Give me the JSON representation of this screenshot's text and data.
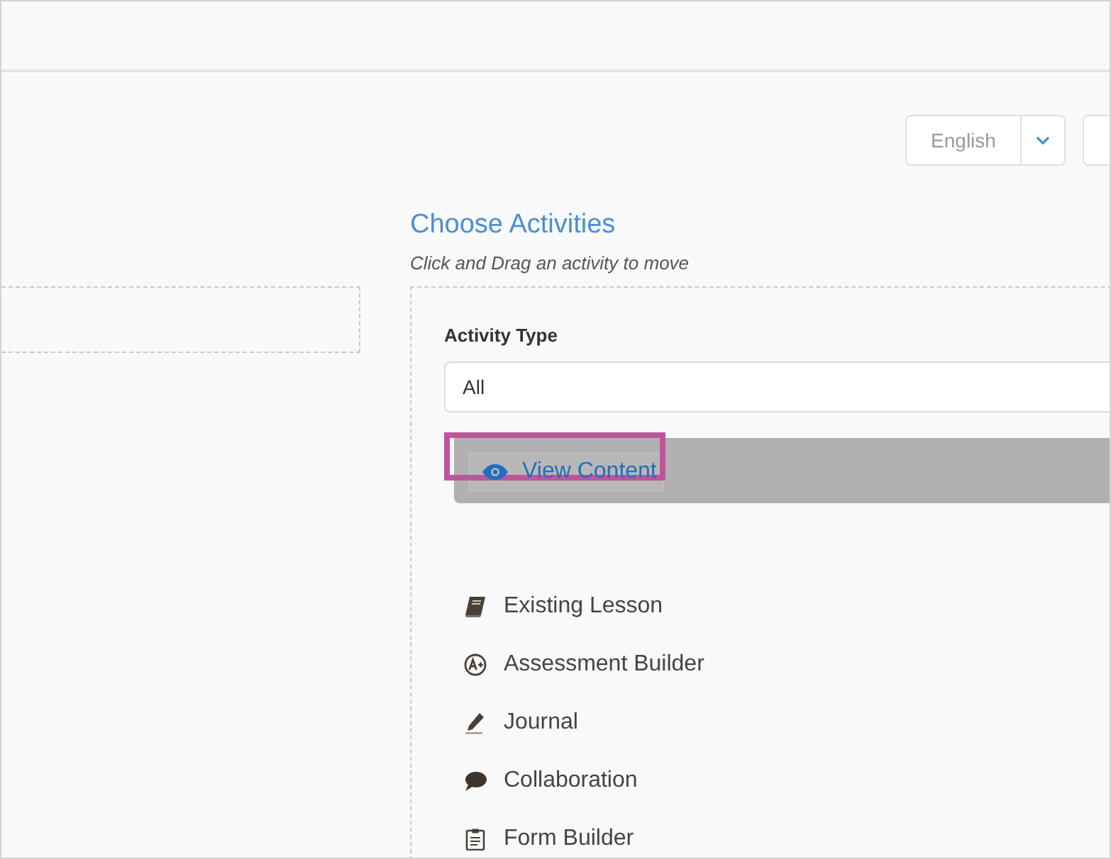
{
  "toolbar": {
    "language": "English"
  },
  "activities_panel": {
    "title": "Choose Activities",
    "hint": "Click and Drag an activity to move",
    "activity_type": {
      "label": "Activity Type",
      "value": "All"
    },
    "drag_preview": {
      "label": "View Content"
    },
    "activities": [
      {
        "kind": "lesson",
        "label": "Existing Lesson"
      },
      {
        "kind": "assessment",
        "label": "Assessment Builder"
      },
      {
        "kind": "journal",
        "label": "Journal"
      },
      {
        "kind": "collaboration",
        "label": "Collaboration"
      },
      {
        "kind": "form",
        "label": "Form Builder"
      }
    ]
  }
}
